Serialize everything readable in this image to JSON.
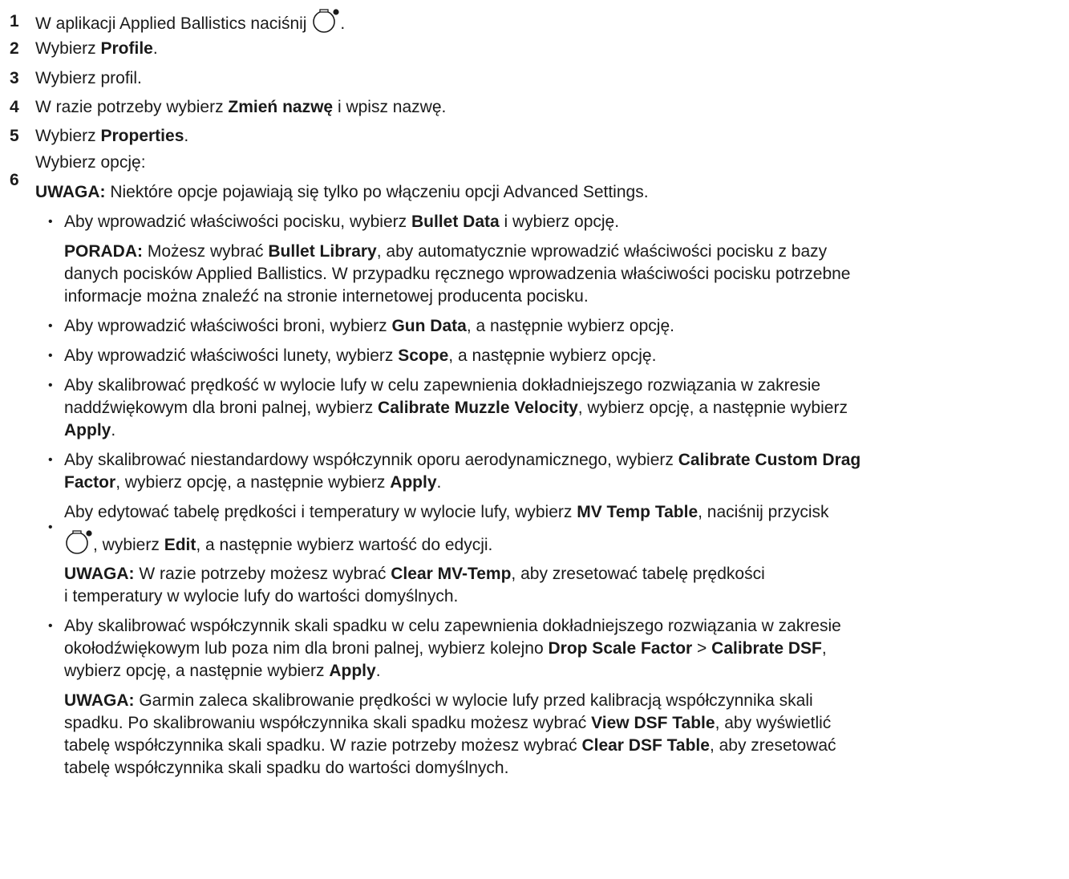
{
  "steps": {
    "s1": {
      "num": "1",
      "pre": "W aplikacji Applied Ballistics naciśnij ",
      "post": ".",
      "icon": "watch-button-icon"
    },
    "s2": {
      "num": "2",
      "pre": "Wybierz ",
      "b1": "Profile",
      "post": "."
    },
    "s3": {
      "num": "3",
      "text": "Wybierz profil."
    },
    "s4": {
      "num": "4",
      "pre": "W razie potrzeby wybierz ",
      "b1": "Zmień nazwę",
      "post": " i wpisz nazwę."
    },
    "s5": {
      "num": "5",
      "pre": "Wybierz ",
      "b1": "Properties",
      "post": "."
    },
    "s6": {
      "num": "6",
      "text": "Wybierz opcję:",
      "note_label": "UWAGA:",
      "note_text": " Niektóre opcje pojawiają się tylko po włączeniu opcji Advanced Settings."
    }
  },
  "bullet_char": "•",
  "b1": {
    "pre": "Aby wprowadzić właściwości pocisku, wybierz ",
    "b1": "Bullet Data",
    "post": " i wybierz opcję.",
    "tip_label": "PORADA:",
    "tip_a": " Możesz wybrać ",
    "tip_b": "Bullet Library",
    "tip_c": ", aby automatycznie wprowadzić właściwości pocisku z bazy",
    "tip_l2": "danych pocisków Applied Ballistics. W przypadku ręcznego wprowadzenia właściwości pocisku potrzebne",
    "tip_l3": "informacje można znaleźć na stronie internetowej producenta pocisku."
  },
  "b2": {
    "pre": "Aby wprowadzić właściwości broni, wybierz ",
    "b1": "Gun Data",
    "post": ", a następnie wybierz opcję."
  },
  "b3": {
    "pre": "Aby wprowadzić właściwości lunety, wybierz ",
    "b1": "Scope",
    "post": ", a następnie wybierz opcję."
  },
  "b4": {
    "l1": "Aby skalibrować prędkość w wylocie lufy w celu zapewnienia dokładniejszego rozwiązania w zakresie",
    "l2_pre": "naddźwiękowym dla broni palnej, wybierz ",
    "l2_b": "Calibrate Muzzle Velocity",
    "l2_post": ", wybierz opcję, a następnie wybierz",
    "l3_b": "Apply",
    "l3_post": "."
  },
  "b5": {
    "l1_pre": "Aby skalibrować niestandardowy współczynnik oporu aerodynamicznego, wybierz ",
    "l1_b": "Calibrate Custom Drag",
    "l2_b": "Factor",
    "l2_mid": ", wybierz opcję, a następnie wybierz ",
    "l2_b2": "Apply",
    "l2_post": "."
  },
  "b6": {
    "l1_pre": "Aby edytować tabelę prędkości i temperatury w wylocie lufy, wybierz ",
    "l1_b": "MV Temp Table",
    "l1_post": ", naciśnij przycisk",
    "l2_a": ", wybierz ",
    "l2_b": "Edit",
    "l2_post": ", a następnie wybierz wartość do edycji.",
    "note_label": "UWAGA:",
    "note_a": " W razie potrzeby możesz wybrać ",
    "note_b": "Clear MV-Temp",
    "note_c": ", aby zresetować tabelę prędkości",
    "note_l2": "i temperatury w wylocie lufy do wartości domyślnych."
  },
  "b7": {
    "l1": "Aby skalibrować współczynnik skali spadku w celu zapewnienia dokładniejszego rozwiązania w zakresie",
    "l2_pre": "okołodźwiękowym lub poza nim dla broni palnej, wybierz kolejno ",
    "l2_b": "Drop Scale Factor",
    "l2_sep": " > ",
    "l2_b2": "Calibrate DSF",
    "l2_post": ",",
    "l3_pre": "wybierz opcję, a następnie wybierz ",
    "l3_b": "Apply",
    "l3_post": ".",
    "note_label": "UWAGA:",
    "note_l1": " Garmin zaleca skalibrowanie prędkości w wylocie lufy przed kalibracją współczynnika skali",
    "note_l2_pre": "spadku. Po skalibrowaniu współczynnika skali spadku możesz wybrać ",
    "note_l2_b": "View DSF Table",
    "note_l2_post": ", aby wyświetlić",
    "note_l3_pre": "tabelę współczynnika skali spadku. W razie potrzeby możesz wybrać ",
    "note_l3_b": "Clear DSF Table",
    "note_l3_post": ", aby zresetować",
    "note_l4": "tabelę współczynnika skali spadku do wartości domyślnych."
  }
}
